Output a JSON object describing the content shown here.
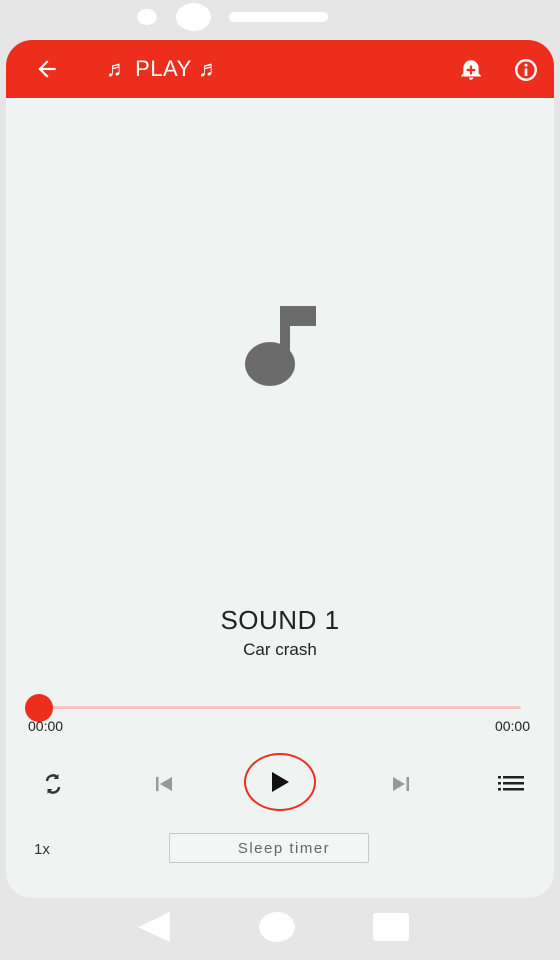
{
  "appbar": {
    "title": "♬ PLAY ♬",
    "color": "#ee2e1c",
    "icons": [
      "back-arrow-icon",
      "alarm-icon",
      "info-icon"
    ]
  },
  "track": {
    "title": "SOUND 1",
    "subtitle": "Car crash",
    "art_icon": "music-note-icon"
  },
  "progress": {
    "elapsed": "00:00",
    "total": "00:00",
    "fraction": 0
  },
  "controls": {
    "icons": [
      "repeat-icon",
      "skip-previous-icon",
      "play-icon",
      "skip-next-icon",
      "playlist-icon"
    ]
  },
  "options": {
    "speed": "1x",
    "sleep_label": "Sleep timer",
    "sleep_icon": "moon-icon"
  },
  "system_nav": [
    "nav-back-icon",
    "nav-home-icon",
    "nav-recents-icon"
  ]
}
